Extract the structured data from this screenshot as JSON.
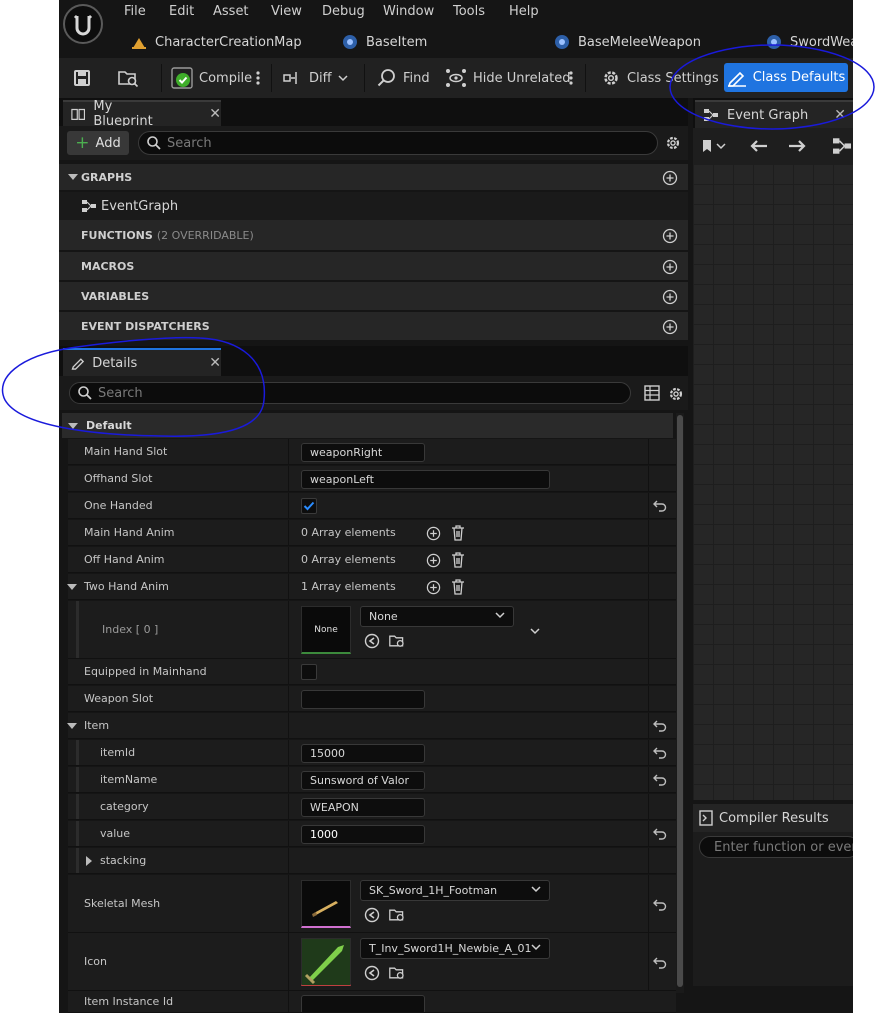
{
  "menu": [
    "File",
    "Edit",
    "Asset",
    "View",
    "Debug",
    "Window",
    "Tools",
    "Help"
  ],
  "doc_tabs": [
    "CharacterCreationMap",
    "BaseItem",
    "BaseMeleeWeapon",
    "SwordWea"
  ],
  "toolbar": {
    "compile": "Compile",
    "diff": "Diff",
    "find": "Find",
    "hide_unrelated": "Hide Unrelated",
    "class_settings": "Class Settings",
    "class_defaults": "Class Defaults"
  },
  "my_blueprint": {
    "tab": "My Blueprint",
    "add": "Add",
    "search_placeholder": "Search",
    "graphs": "GRAPHS",
    "event_graph_item": "EventGraph",
    "functions": "FUNCTIONS",
    "functions_sub": "(2 OVERRIDABLE)",
    "macros": "MACROS",
    "variables": "VARIABLES",
    "event_dispatchers": "EVENT DISPATCHERS"
  },
  "event_graph_tab": "Event Graph",
  "details": {
    "tab": "Details",
    "search_placeholder": "Search",
    "category_default": "Default",
    "main_hand_slot": {
      "label": "Main Hand Slot",
      "value": "weaponRight"
    },
    "offhand_slot": {
      "label": "Offhand Slot",
      "value": "weaponLeft"
    },
    "one_handed": {
      "label": "One Handed",
      "checked": true
    },
    "main_hand_anim": {
      "label": "Main Hand Anim",
      "value": "0 Array elements"
    },
    "off_hand_anim": {
      "label": "Off Hand Anim",
      "value": "0 Array elements"
    },
    "two_hand_anim": {
      "label": "Two Hand Anim",
      "value": "1 Array elements"
    },
    "index0": {
      "label": "Index [ 0 ]",
      "thumb": "None",
      "value": "None"
    },
    "equipped_in_mainhand": {
      "label": "Equipped in Mainhand",
      "checked": false
    },
    "weapon_slot": {
      "label": "Weapon Slot",
      "value": ""
    },
    "item": {
      "label": "Item"
    },
    "item_id": {
      "label": "itemId",
      "value": "15000"
    },
    "item_name": {
      "label": "itemName",
      "value": "Sunsword of Valor"
    },
    "category": {
      "label": "category",
      "value": "WEAPON"
    },
    "value": {
      "label": "value",
      "value": "1000"
    },
    "stacking": {
      "label": "stacking"
    },
    "skeletal_mesh": {
      "label": "Skeletal Mesh",
      "value": "SK_Sword_1H_Footman"
    },
    "icon": {
      "label": "Icon",
      "value": "T_Inv_Sword1H_Newbie_A_01"
    },
    "item_instance_id": {
      "label": "Item Instance Id"
    }
  },
  "compiler": {
    "tab": "Compiler Results",
    "search_placeholder": "Enter function or event"
  },
  "colors": {
    "accent": "#1f74e0",
    "annotation": "#1a1adb"
  }
}
